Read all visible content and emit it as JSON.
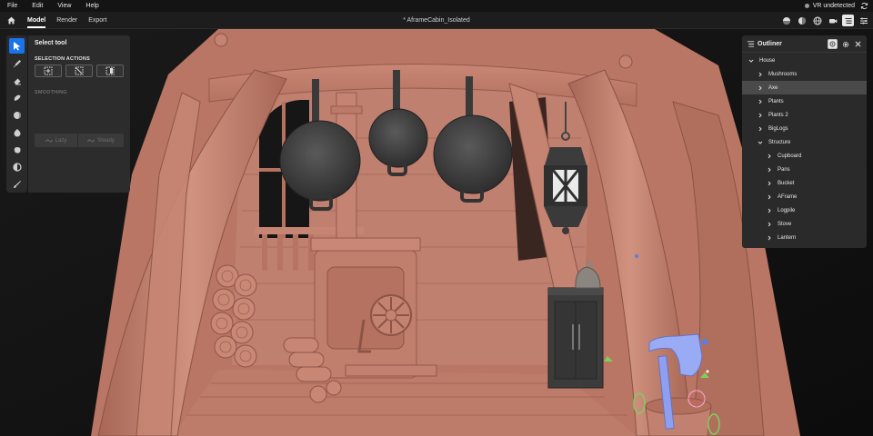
{
  "menu": {
    "items": [
      "File",
      "Edit",
      "View",
      "Help"
    ],
    "vr_status": "VR undetected"
  },
  "workspace": {
    "tabs": [
      {
        "label": "Model",
        "active": true
      },
      {
        "label": "Render",
        "active": false
      },
      {
        "label": "Export",
        "active": false
      }
    ],
    "document_title": "* AframeCabin_Isolated"
  },
  "tool_panel": {
    "title": "Select tool",
    "selection_actions_label": "SELECTION ACTIONS",
    "smoothing_label": "SMOOTHING",
    "smoothing_options": [
      "Lazy",
      "Steady"
    ]
  },
  "outliner": {
    "title": "Outliner",
    "items": [
      {
        "label": "House",
        "depth": 0,
        "expanded": true,
        "selected": false
      },
      {
        "label": "Mushrooms",
        "depth": 1,
        "expanded": false,
        "selected": false
      },
      {
        "label": "Axe",
        "depth": 1,
        "expanded": false,
        "selected": true
      },
      {
        "label": "Plants",
        "depth": 1,
        "expanded": false,
        "selected": false
      },
      {
        "label": "Plants 2",
        "depth": 1,
        "expanded": false,
        "selected": false
      },
      {
        "label": "BigLogs",
        "depth": 1,
        "expanded": false,
        "selected": false
      },
      {
        "label": "Structure",
        "depth": 1,
        "expanded": true,
        "selected": false
      },
      {
        "label": "Cupboard",
        "depth": 2,
        "expanded": false,
        "selected": false
      },
      {
        "label": "Pans",
        "depth": 2,
        "expanded": false,
        "selected": false
      },
      {
        "label": "Bucket",
        "depth": 2,
        "expanded": false,
        "selected": false
      },
      {
        "label": "AFrame",
        "depth": 2,
        "expanded": false,
        "selected": false
      },
      {
        "label": "Logpile",
        "depth": 2,
        "expanded": false,
        "selected": false
      },
      {
        "label": "Stove",
        "depth": 2,
        "expanded": false,
        "selected": false
      },
      {
        "label": "Lantern",
        "depth": 2,
        "expanded": false,
        "selected": false
      }
    ]
  },
  "colors": {
    "accent": "#1a73e8",
    "clay": "#c98472",
    "clay_dark": "#9e5f50",
    "metal": "#3f3f3f",
    "axe_handle": "#8f9ff0"
  },
  "icons": {
    "home": "home-icon",
    "sync": "sync-icon",
    "tools": [
      "select-arrow-icon",
      "pen-icon",
      "eraser-icon",
      "smooth-brush-icon",
      "sphere-icon",
      "paint-drop-icon",
      "blob-icon",
      "half-circle-icon",
      "brush-icon"
    ],
    "header_right": [
      "material-icon",
      "light-icon",
      "globe-icon",
      "camera-icon",
      "outliner-toggle-icon",
      "properties-icon"
    ]
  }
}
